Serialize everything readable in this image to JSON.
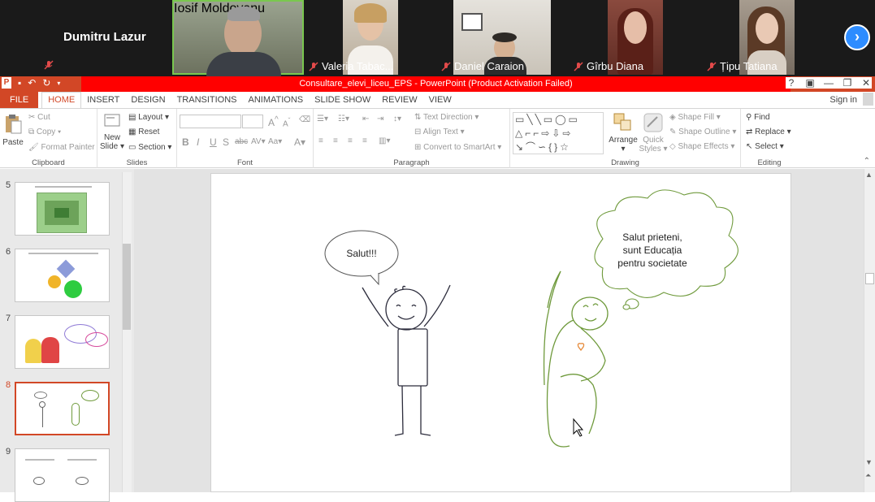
{
  "zoom": {
    "participants": [
      {
        "name": "Dumitru Lazur",
        "video": false
      },
      {
        "name": "Iosif Moldovanu",
        "video": true
      },
      {
        "name": "Valeria Tabac...",
        "video": true
      },
      {
        "name": "Daniel Caraion",
        "video": true
      },
      {
        "name": "Gîrbu Diana",
        "video": true
      },
      {
        "name": "Țipu Tatiana",
        "video": true
      }
    ],
    "next_icon": "chevron-right-icon"
  },
  "titlebar": {
    "title": "Consultare_elevi_liceu_EPS  -  PowerPoint (Product Activation Failed)",
    "help": "?",
    "controls": [
      "restore-ribbon-icon",
      "minimize-icon",
      "maximize-icon",
      "close-icon"
    ]
  },
  "tabs": [
    "FILE",
    "HOME",
    "INSERT",
    "DESIGN",
    "TRANSITIONS",
    "ANIMATIONS",
    "SLIDE SHOW",
    "REVIEW",
    "VIEW"
  ],
  "signin": "Sign in",
  "ribbon": {
    "clipboard": {
      "paste": "Paste",
      "cut": "Cut",
      "copy": "Copy",
      "format_painter": "Format Painter",
      "label": "Clipboard"
    },
    "slides": {
      "new_slide": "New",
      "new_slide2": "Slide",
      "layout": "Layout",
      "reset": "Reset",
      "section": "Section",
      "label": "Slides"
    },
    "font": {
      "label": "Font",
      "bold": "B",
      "italic": "I",
      "underline": "U",
      "strike": "S",
      "shadow": "abc",
      "spacing": "AV",
      "case": "Aa",
      "color": "A",
      "grow": "A",
      "shrink": "A"
    },
    "paragraph": {
      "text_direction": "Text Direction",
      "align_text": "Align Text",
      "convert": "Convert to SmartArt",
      "label": "Paragraph"
    },
    "drawing": {
      "arrange": "Arrange",
      "quick_styles": "Quick",
      "quick_styles2": "Styles",
      "shape_fill": "Shape Fill",
      "shape_outline": "Shape Outline",
      "shape_effects": "Shape Effects",
      "label": "Drawing"
    },
    "editing": {
      "find": "Find",
      "replace": "Replace",
      "select": "Select",
      "label": "Editing"
    }
  },
  "thumbnails": [
    {
      "num": "5"
    },
    {
      "num": "6"
    },
    {
      "num": "7"
    },
    {
      "num": "8",
      "selected": true
    },
    {
      "num": "9"
    }
  ],
  "slide": {
    "bubble_left": "Salut!!!",
    "bubble_right_1": "Salut prieteni,",
    "bubble_right_2": "sunt Educația",
    "bubble_right_3": "pentru societate"
  },
  "colors": {
    "accent": "#d24726",
    "title_red": "#ff0000",
    "green_figure": "#6f9a3c"
  }
}
